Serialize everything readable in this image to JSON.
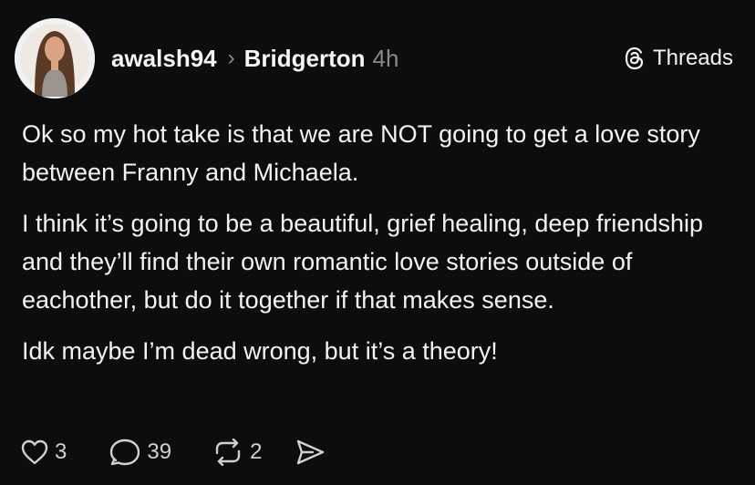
{
  "post": {
    "username": "awalsh94",
    "separator": "›",
    "community": "Bridgerton",
    "time": "4h",
    "brand": "Threads",
    "paragraphs": [
      "Ok so my hot take is that we are NOT going to get a love story between Franny and Michaela.",
      "I think it’s going to be a beautiful, grief healing, deep friendship and they’ll find their own romantic love stories outside of eachother, but do it together if that makes sense.",
      "Idk maybe I’m dead wrong, but it’s a theory!"
    ]
  },
  "actions": {
    "likes": "3",
    "replies": "39",
    "reposts": "2"
  },
  "icons": {
    "brand": "threads-logo-icon",
    "like": "heart-icon",
    "reply": "speech-bubble-icon",
    "repost": "repost-icon",
    "share": "send-icon"
  },
  "colors": {
    "background": "#0d0d0d",
    "text": "#f3f3f3",
    "muted": "#8a8a8a"
  }
}
